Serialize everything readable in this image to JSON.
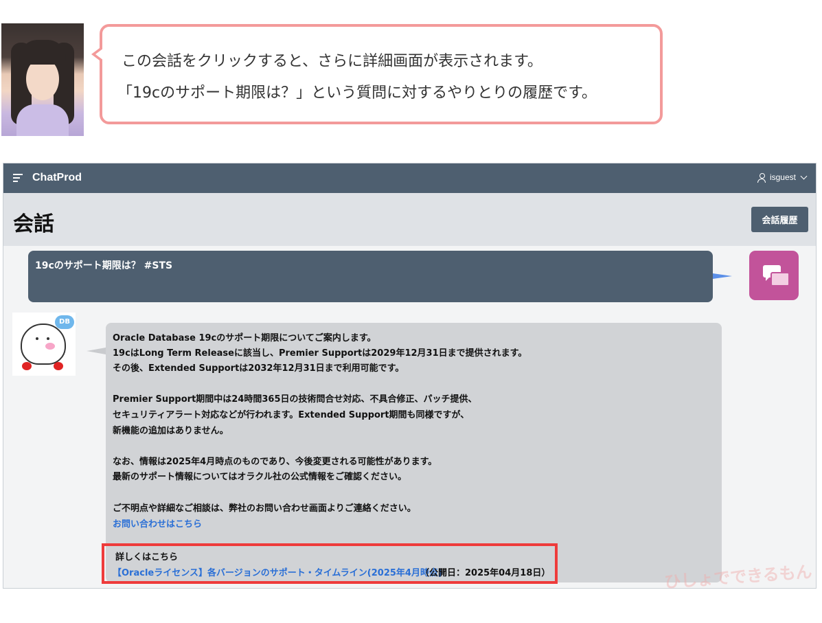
{
  "speech": {
    "line1": "この会話をクリックすると、さらに詳細画面が表示されます。",
    "line2": "「19cのサポート期限は？」という質問に対するやりとりの履歴です。"
  },
  "app": {
    "title": "ChatProd",
    "user": "isguest",
    "page_title": "会話",
    "history_button": "会話履歴"
  },
  "conversation": {
    "user_message": "19cのサポート期限は？ #STS",
    "bot_lines": [
      "Oracle Database 19cのサポート期限についてご案内します。",
      "19cはLong Term Releaseに該当し、Premier Supportは2029年12月31日まで提供されます。",
      "その後、Extended Supportは2032年12月31日まで利用可能です。",
      "Premier Support期間中は24時間365日の技術問合せ対応、不具合修正、パッチ提供、",
      "セキュリティアラート対応などが行われます。Extended Support期間も同様ですが、",
      "新機能の追加はありません。",
      "なお、情報は2025年4月時点のものであり、今後変更される可能性があります。",
      "最新のサポート情報についてはオラクル社の公式情報をご確認ください。",
      "ご不明点や詳細なご相談は、弊社のお問い合わせ画面よりご連絡ください。"
    ],
    "contact_link": "お問い合わせはこちら",
    "details_label": "詳しくはこちら",
    "details_link": "【Oracleライセンス】各バージョンのサポート・タイムライン(2025年4月時点)",
    "details_date": "（公開日：2025年04月18日）"
  },
  "watermark": "ひしょでできるもん",
  "colors": {
    "navbar": "#4e5f70",
    "accent_pink": "#c2539a",
    "speech_border": "#f39a9a",
    "highlight": "#ee3b3b",
    "link": "#2a6fd6"
  }
}
